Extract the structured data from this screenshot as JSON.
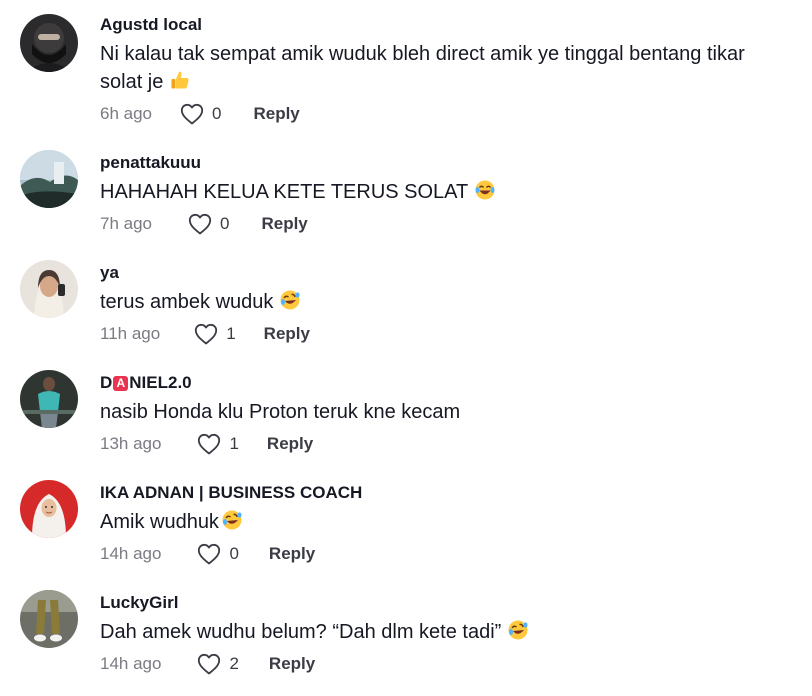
{
  "comments": [
    {
      "username": "Agustd local",
      "text": "Ni kalau tak sempat amik wuduk bleh direct amik ye tinggal bentang tikar solat je",
      "emoji": "thumbs-up-emoji",
      "time": "6h ago",
      "likes": "0",
      "reply_label": "Reply"
    },
    {
      "username": "penattakuuu",
      "text": "HAHAHAH KELUA KETE TERUS SOLAT",
      "emoji": "tears-of-joy-emoji",
      "time": "7h ago",
      "likes": "0",
      "reply_label": "Reply"
    },
    {
      "username": "ya",
      "text": "terus ambek wuduk",
      "emoji": "rofl-emoji",
      "time": "11h ago",
      "likes": "1",
      "reply_label": "Reply"
    },
    {
      "username_prefix": "D",
      "username_badge": "A",
      "username_suffix": "NIEL2.0",
      "text": "nasib Honda klu Proton teruk kne kecam",
      "time": "13h ago",
      "likes": "1",
      "reply_label": "Reply"
    },
    {
      "username": "IKA ADNAN | BUSINESS COACH",
      "text": "Amik wudhuk",
      "emoji": "rofl-emoji",
      "time": "14h ago",
      "likes": "0",
      "reply_label": "Reply"
    },
    {
      "username": "LuckyGirl",
      "text": "Dah amek wudhu belum? “Dah dlm kete tadi”",
      "emoji": "rofl-emoji",
      "time": "14h ago",
      "likes": "2",
      "reply_label": "Reply"
    }
  ],
  "colors": {
    "text": "#161823",
    "muted": "#7a7b83",
    "badge": "#e8344e"
  }
}
